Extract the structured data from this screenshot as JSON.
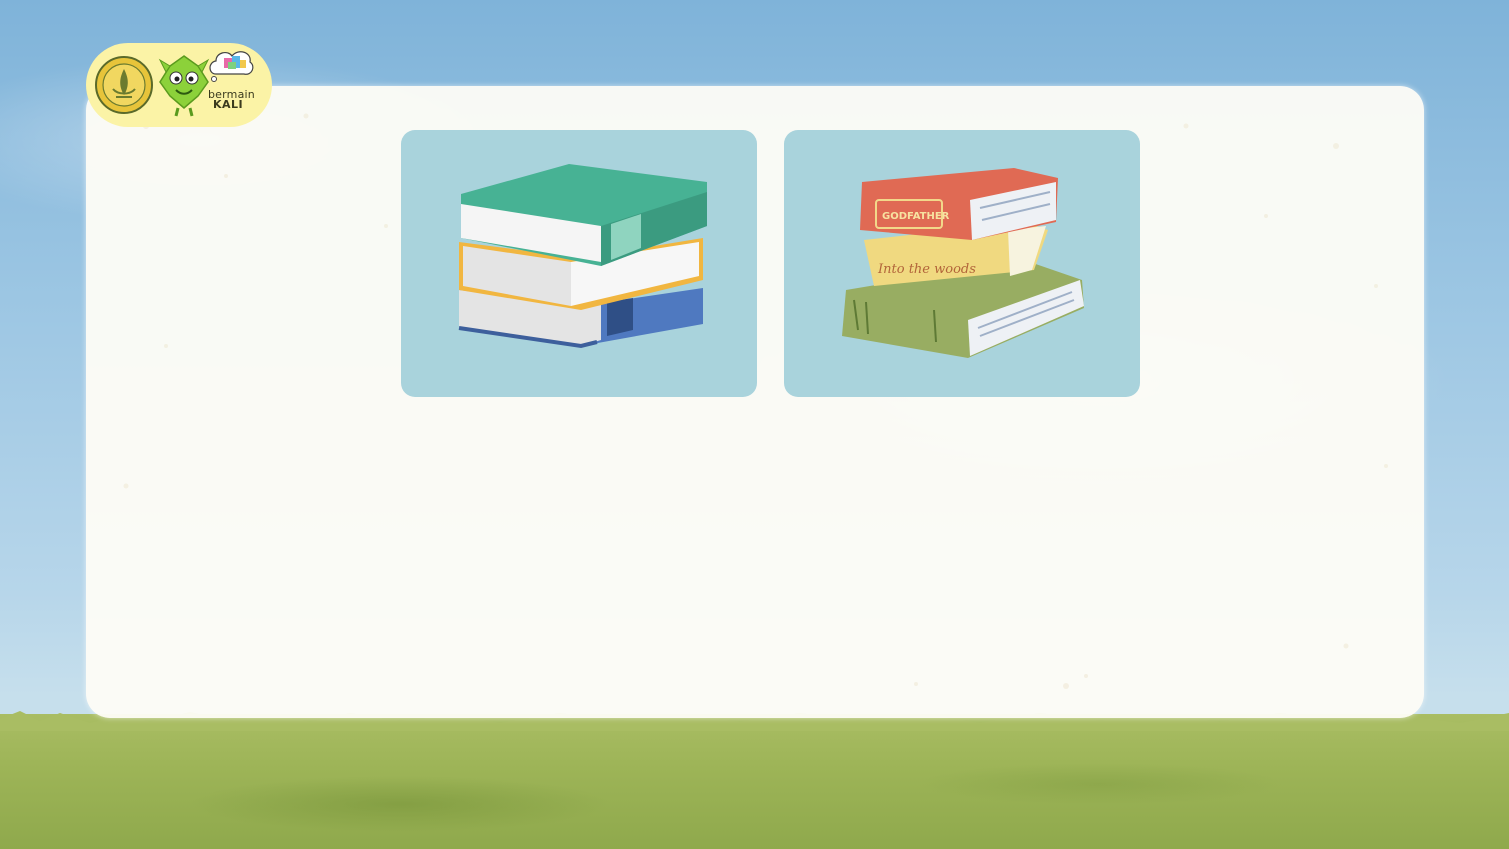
{
  "header": {
    "brand": {
      "line1": "bermain",
      "line2": "KALI"
    },
    "icons": {
      "emblem": "university-emblem-icon",
      "mascot": "green-mascot-icon",
      "bubble": "thought-bubble-gift-icon"
    }
  },
  "main": {
    "tiles": [
      {
        "name": "book-stack-1",
        "books": [
          "teal",
          "yellow",
          "blue"
        ]
      },
      {
        "name": "book-stack-2",
        "books": [
          "red",
          "yellow",
          "green"
        ],
        "spine_labels": [
          "GODFATHER",
          "Into the woods"
        ]
      }
    ]
  },
  "colors": {
    "sky": "#9cc6e3",
    "card": "#fdfcf6",
    "grass": "#9db457",
    "tile": "#a9d3dc",
    "badge": "#fbf3a6"
  }
}
